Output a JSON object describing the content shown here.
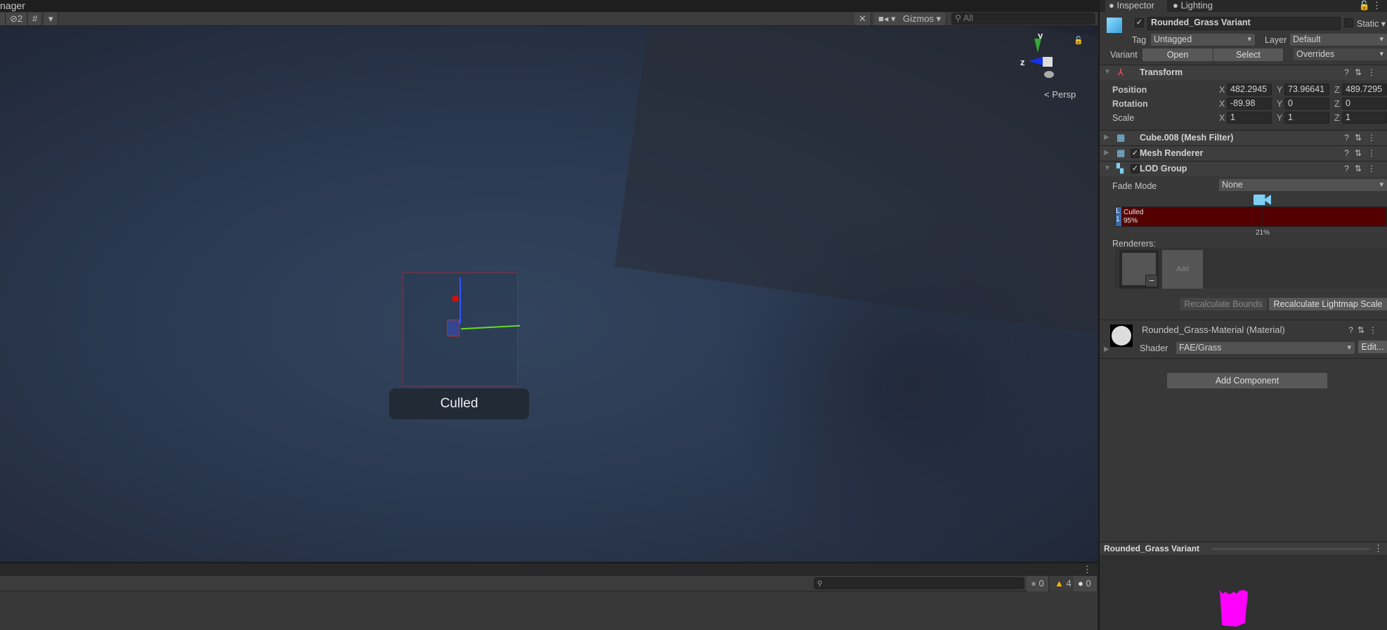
{
  "topbar": {
    "title": "nager"
  },
  "scene_toolbar": {
    "hidden_count": "2",
    "gizmos_label": "Gizmos",
    "search_placeholder": "All"
  },
  "scene": {
    "projection": "Persp",
    "axis_y": "y",
    "axis_z": "z",
    "culled_label": "Culled"
  },
  "console": {
    "info_count": "0",
    "warn_count": "4",
    "error_count": "0"
  },
  "inspector": {
    "tabs": [
      {
        "label": "Inspector"
      },
      {
        "label": "Lighting"
      }
    ],
    "object_name": "Rounded_Grass Variant",
    "static_label": "Static",
    "tag_label": "Tag",
    "tag_value": "Untagged",
    "layer_label": "Layer",
    "layer_value": "Default",
    "variant_label": "Variant",
    "open_label": "Open",
    "select_label": "Select",
    "overrides_label": "Overrides",
    "transform": {
      "title": "Transform",
      "rows": [
        {
          "label": "Position",
          "x": "482.2945",
          "y": "73.96641",
          "z": "489.7295"
        },
        {
          "label": "Rotation",
          "x": "-89.98",
          "y": "0",
          "z": "0"
        },
        {
          "label": "Scale",
          "x": "1",
          "y": "1",
          "z": "1"
        }
      ]
    },
    "mesh_filter": {
      "title": "Cube.008 (Mesh Filter)"
    },
    "mesh_renderer": {
      "title": "Mesh Renderer"
    },
    "lod_group": {
      "title": "LOD Group",
      "fade_mode_label": "Fade Mode",
      "fade_mode_value": "None",
      "lod0_label": "L",
      "lod0_pct": "1",
      "culled_label": "Culled",
      "culled_pct": "95%",
      "camera_pct": "21%",
      "renderers_label": "Renderers:",
      "add_label": "Add",
      "remove_label": "−",
      "recalc_bounds": "Recalculate Bounds",
      "recalc_lightmap": "Recalculate Lightmap Scale"
    },
    "material": {
      "title": "Rounded_Grass-Material (Material)",
      "shader_label": "Shader",
      "shader_value": "FAE/Grass",
      "edit_label": "Edit..."
    },
    "add_component": "Add Component",
    "preview_title": "Rounded_Grass Variant"
  },
  "colors": {
    "culled": "#550000",
    "camera": "#7fcff5",
    "preview_mesh": "#ff00ff"
  }
}
